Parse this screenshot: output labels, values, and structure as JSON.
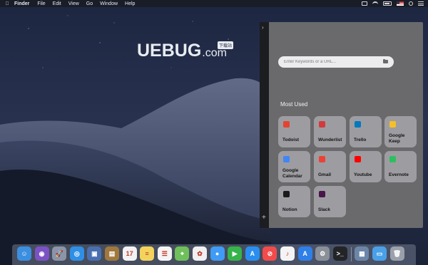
{
  "menubar": {
    "apple_icon": "apple-logo-icon",
    "app_name": "Finder",
    "items": [
      "File",
      "Edit",
      "View",
      "Go",
      "Window",
      "Help"
    ]
  },
  "watermark": {
    "main": "UEBUG",
    "suffix": ".com",
    "badge": "下载站"
  },
  "panel": {
    "search_placeholder": "Enter Keywords or a URL...",
    "section_title": "Most Used",
    "tiles": [
      {
        "label": "Todoist",
        "icon": "todoist-icon",
        "color": "#e44332"
      },
      {
        "label": "Wunderlist",
        "icon": "wunderlist-icon",
        "color": "#d23b3b"
      },
      {
        "label": "Trello",
        "icon": "trello-icon",
        "color": "#0079bf"
      },
      {
        "label": "Google Keep",
        "icon": "google-keep-icon",
        "color": "#f6bf26"
      },
      {
        "label": "Google Calendar",
        "icon": "google-calendar-icon",
        "color": "#4285f4"
      },
      {
        "label": "Gmail",
        "icon": "gmail-icon",
        "color": "#ea4335"
      },
      {
        "label": "Youtube",
        "icon": "youtube-icon",
        "color": "#ff0000"
      },
      {
        "label": "Evernote",
        "icon": "evernote-icon",
        "color": "#2dbe60"
      },
      {
        "label": "Notion",
        "icon": "notion-icon",
        "color": "#1a1a1a"
      },
      {
        "label": "Slack",
        "icon": "slack-icon",
        "color": "#4a154b"
      }
    ]
  },
  "dock": {
    "apps": [
      {
        "icon": "finder-icon",
        "color": "#3b8fe0",
        "glyph": "☺"
      },
      {
        "icon": "siri-icon",
        "color": "#7b52c4",
        "glyph": "◉"
      },
      {
        "icon": "launchpad-icon",
        "color": "#8a95a8",
        "glyph": "🚀"
      },
      {
        "icon": "safari-icon",
        "color": "#2f8fe6",
        "glyph": "◎"
      },
      {
        "icon": "photo-browser-icon",
        "color": "#4a6fb0",
        "glyph": "▣"
      },
      {
        "icon": "notebook-icon",
        "color": "#a0783c",
        "glyph": "▤"
      },
      {
        "icon": "calendar-icon",
        "color": "#f2f2f2",
        "glyph": "17"
      },
      {
        "icon": "notes-icon",
        "color": "#f3d35c",
        "glyph": "≡"
      },
      {
        "icon": "reminders-icon",
        "color": "#f4f4f4",
        "glyph": "☰"
      },
      {
        "icon": "maps-icon",
        "color": "#6fbf5a",
        "glyph": "⌖"
      },
      {
        "icon": "photos-icon",
        "color": "#f0f0f0",
        "glyph": "✿"
      },
      {
        "icon": "messages-icon",
        "color": "#3f9bf5",
        "glyph": "●"
      },
      {
        "icon": "facetime-icon",
        "color": "#36b34a",
        "glyph": "▶"
      },
      {
        "icon": "app-store-icon",
        "color": "#2a8ef0",
        "glyph": "A"
      },
      {
        "icon": "news-icon",
        "color": "#f24b4b",
        "glyph": "⊘"
      },
      {
        "icon": "music-icon",
        "color": "#f4f4f4",
        "glyph": "♪"
      },
      {
        "icon": "app-store-alt-icon",
        "color": "#2f7fe8",
        "glyph": "A"
      },
      {
        "icon": "system-preferences-icon",
        "color": "#8a8f98",
        "glyph": "⚙"
      },
      {
        "icon": "terminal-icon",
        "color": "#222426",
        "glyph": ">_"
      },
      {
        "icon": "preview-icon",
        "color": "#6c86a8",
        "glyph": "▦"
      },
      {
        "icon": "downloads-folder-icon",
        "color": "#4aa0e8",
        "glyph": "▭"
      },
      {
        "icon": "trash-icon",
        "color": "#9aa1ab",
        "glyph": "🗑"
      }
    ]
  }
}
